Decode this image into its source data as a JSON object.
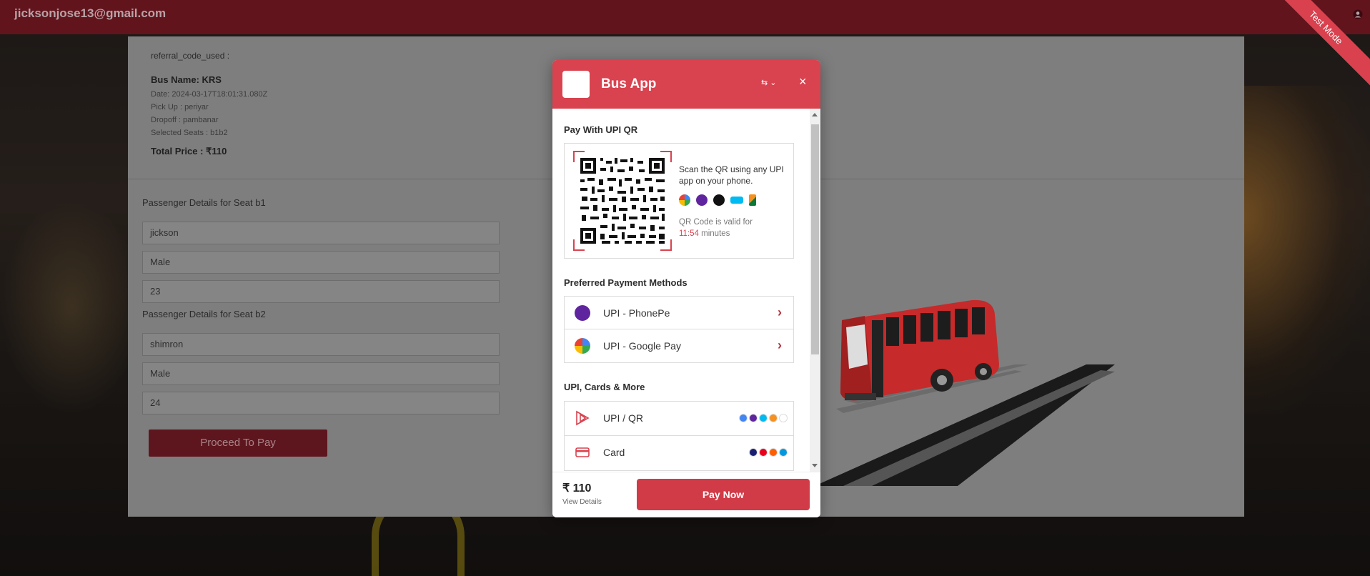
{
  "topbar": {
    "email": "jicksonjose13@gmail.com",
    "test_mode": "Test Mode"
  },
  "booking": {
    "referral": "referral_code_used :",
    "bus_name": "Bus Name: KRS",
    "date": "Date: 2024-03-17T18:01:31.080Z",
    "pickup": "Pick Up : periyar",
    "dropoff": "Dropoff : pambanar",
    "seats": "Selected Seats : b1b2",
    "total": "Total Price : ₹110"
  },
  "passengers": [
    {
      "title": "Passenger Details for Seat b1",
      "name": "jickson",
      "gender": "Male",
      "age": "23"
    },
    {
      "title": "Passenger Details for Seat b2",
      "name": "shimron",
      "gender": "Male",
      "age": "24"
    }
  ],
  "proceed_label": "Proceed To Pay",
  "modal": {
    "title": "Bus App",
    "close": "×",
    "lang": "⇆ ⌄",
    "qr_section_title": "Pay With UPI QR",
    "qr_scan_text": "Scan the QR using any UPI app on your phone.",
    "qr_valid_prefix": "QR Code is valid for",
    "qr_valid_time": "11:54",
    "qr_valid_suffix": "minutes",
    "preferred_title": "Preferred Payment Methods",
    "preferred": [
      {
        "label": "UPI - PhonePe",
        "icon": "phonepe-icon"
      },
      {
        "label": "UPI - Google Pay",
        "icon": "googlepay-icon"
      }
    ],
    "more_title": "UPI, Cards & More",
    "more": [
      {
        "label": "UPI / QR",
        "icon": "upi-icon"
      },
      {
        "label": "Card",
        "icon": "card-icon"
      }
    ],
    "amount": "₹ 110",
    "view_details": "View Details",
    "pay_now": "Pay Now"
  },
  "colors": {
    "accent": "#d8434f",
    "topbar": "#62141d",
    "button_dark": "#5e161e"
  }
}
